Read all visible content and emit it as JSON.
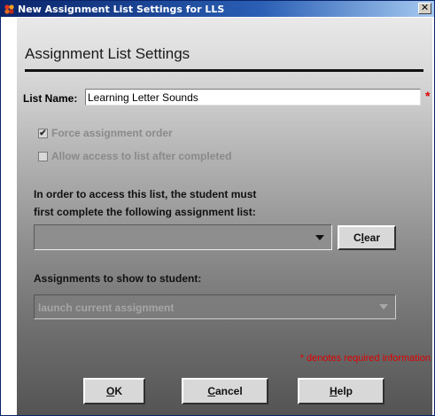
{
  "window": {
    "title": "New Assignment List Settings for LLS",
    "close_glyph": "✕",
    "icon": "app-icon"
  },
  "form": {
    "heading": "Assignment List Settings",
    "list_name_label": "List Name:",
    "list_name_value": "Learning Letter Sounds",
    "required_marker": "*",
    "checkbox_force": {
      "label": "Force assignment order",
      "checked": true,
      "glyph": "✔"
    },
    "checkbox_allow": {
      "label": "Allow access to list after completed",
      "checked": false
    },
    "prereq_line1": "In order to access this list, the student must",
    "prereq_line2": "first complete the following assignment list:",
    "prereq_select_value": "",
    "clear_button": {
      "pre": "C",
      "underline": "l",
      "post": "ear"
    },
    "assignments_label": "Assignments to show to student:",
    "assignments_select_value": "launch current assignment",
    "required_note": "* denotes required information"
  },
  "buttons": {
    "ok": {
      "underline": "O",
      "post": "K"
    },
    "cancel": {
      "underline": "C",
      "post": "ancel"
    },
    "help": {
      "underline": "H",
      "post": "elp"
    }
  },
  "colors": {
    "title_bar": "#0a246a",
    "required": "#e00000"
  }
}
